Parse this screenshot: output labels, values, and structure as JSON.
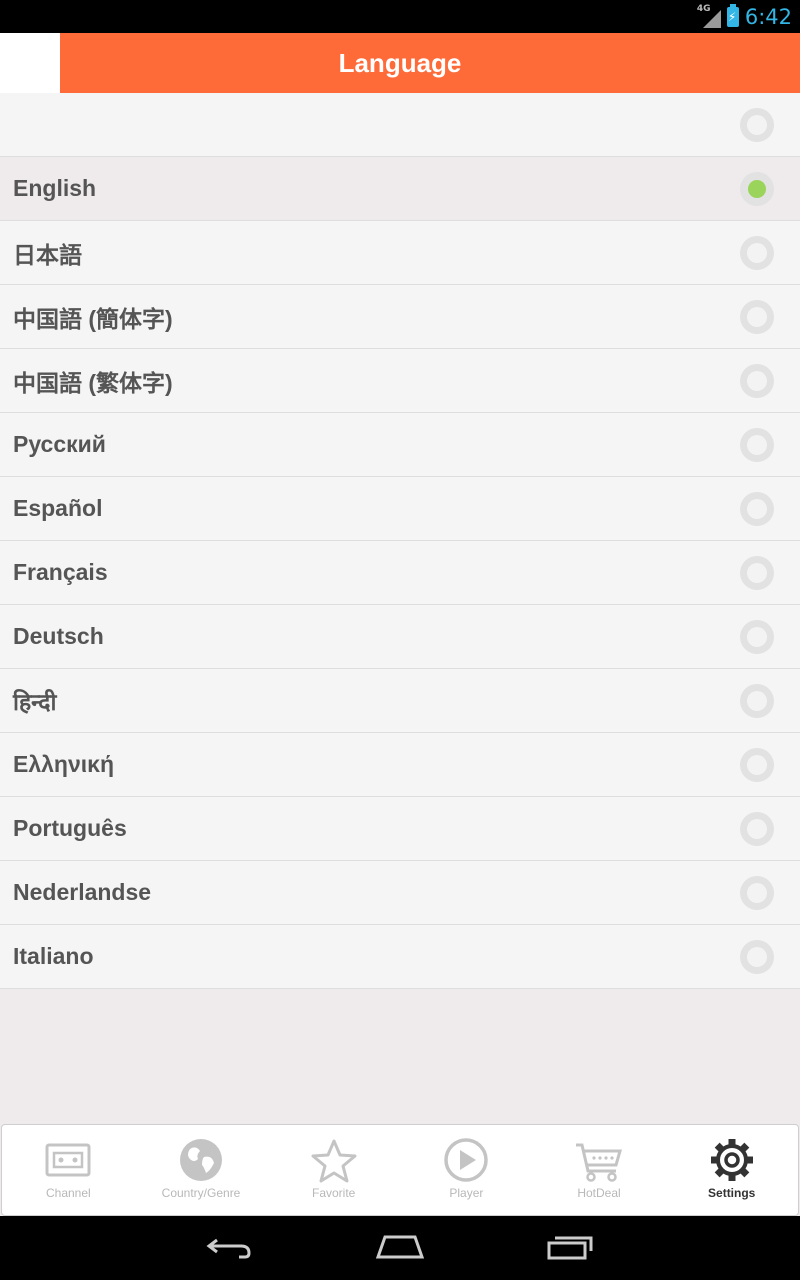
{
  "status_bar": {
    "network": "4G",
    "time": "6:42"
  },
  "header": {
    "title": "Language"
  },
  "languages": [
    {
      "label": "",
      "selected": false
    },
    {
      "label": "English",
      "selected": true
    },
    {
      "label": "日本語",
      "selected": false
    },
    {
      "label": "中国語 (簡体字)",
      "selected": false
    },
    {
      "label": "中国語 (繁体字)",
      "selected": false
    },
    {
      "label": "Русский",
      "selected": false
    },
    {
      "label": "Español",
      "selected": false
    },
    {
      "label": "Français",
      "selected": false
    },
    {
      "label": "Deutsch",
      "selected": false
    },
    {
      "label": "हिन्दी",
      "selected": false
    },
    {
      "label": "Ελληνική",
      "selected": false
    },
    {
      "label": "Português",
      "selected": false
    },
    {
      "label": "Nederlandse",
      "selected": false
    },
    {
      "label": "Italiano",
      "selected": false
    }
  ],
  "tabs": [
    {
      "label": "Channel",
      "icon": "radio-icon",
      "active": false
    },
    {
      "label": "Country/Genre",
      "icon": "globe-icon",
      "active": false
    },
    {
      "label": "Favorite",
      "icon": "star-icon",
      "active": false
    },
    {
      "label": "Player",
      "icon": "play-icon",
      "active": false
    },
    {
      "label": "HotDeal",
      "icon": "cart-icon",
      "active": false
    },
    {
      "label": "Settings",
      "icon": "gear-icon",
      "active": true
    }
  ],
  "colors": {
    "accent": "#ff6a39",
    "selected_radio": "#9ad45b",
    "status_accent": "#33b5e5"
  }
}
